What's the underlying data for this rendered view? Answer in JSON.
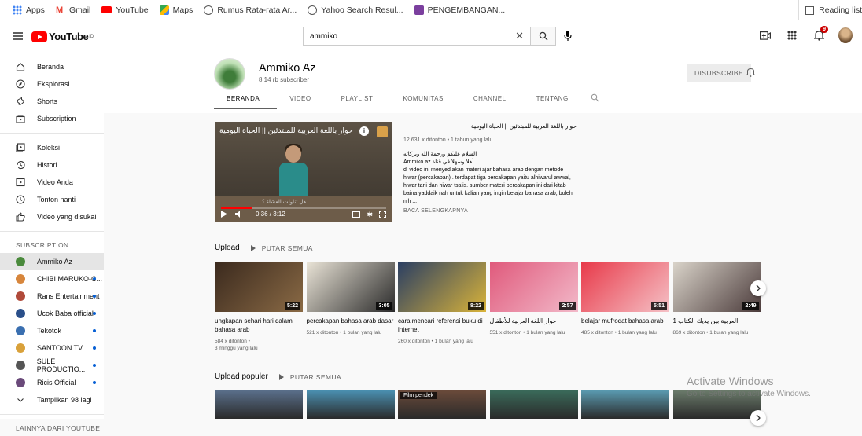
{
  "bookmarks": {
    "items": [
      {
        "label": "Apps",
        "icon": "apps-grid-icon",
        "color": "#4285f4"
      },
      {
        "label": "Gmail",
        "icon": "gmail-icon",
        "color": "#ea4335"
      },
      {
        "label": "YouTube",
        "icon": "youtube-icon",
        "color": "#ff0000"
      },
      {
        "label": "Maps",
        "icon": "maps-icon",
        "color": "#34a853"
      },
      {
        "label": "Rumus Rata-rata Ar...",
        "icon": "globe-icon",
        "color": "#555555"
      },
      {
        "label": "Yahoo Search Resul...",
        "icon": "globe-icon",
        "color": "#555555"
      },
      {
        "label": "PENGEMBANGAN...",
        "icon": "bookmark-favicon-icon",
        "color": "#7b3f9e"
      }
    ],
    "reading_list": "Reading list"
  },
  "masthead": {
    "logo_text": "YouTube",
    "logo_region": "ID",
    "search_value": "ammiko",
    "notification_count": "9"
  },
  "sidebar": {
    "main": [
      {
        "label": "Beranda",
        "icon": "home-icon"
      },
      {
        "label": "Eksplorasi",
        "icon": "compass-icon"
      },
      {
        "label": "Shorts",
        "icon": "shorts-icon"
      },
      {
        "label": "Subscription",
        "icon": "subscriptions-icon"
      }
    ],
    "library": [
      {
        "label": "Koleksi",
        "icon": "library-icon"
      },
      {
        "label": "Histori",
        "icon": "history-icon"
      },
      {
        "label": "Video Anda",
        "icon": "your-videos-icon"
      },
      {
        "label": "Tonton nanti",
        "icon": "watch-later-icon"
      },
      {
        "label": "Video yang disukai",
        "icon": "thumbs-up-icon"
      }
    ],
    "subscription_heading": "SUBSCRIPTION",
    "subscriptions": [
      {
        "label": "Ammiko Az",
        "active": true,
        "dot": false,
        "color": "#4a8a3c"
      },
      {
        "label": "CHIBI MARUKO-C...",
        "dot": true,
        "color": "#d7863c"
      },
      {
        "label": "Rans Entertainment",
        "dot": true,
        "color": "#b04a3a"
      },
      {
        "label": "Ucok Baba official",
        "dot": true,
        "color": "#2a4f8a"
      },
      {
        "label": "Tekotok",
        "dot": true,
        "color": "#3a6fb0"
      },
      {
        "label": "SANTOON TV",
        "dot": true,
        "color": "#d9a13a"
      },
      {
        "label": "SULE PRODUCTIO...",
        "dot": true,
        "color": "#555555"
      },
      {
        "label": "Ricis Official",
        "dot": true,
        "color": "#6a4a7a"
      }
    ],
    "show_more": "Tampilkan 98 lagi",
    "more_heading": "LAINNYA DARI YOUTUBE"
  },
  "channel": {
    "name": "Ammiko Az",
    "subscribers": "8,14 rb subscriber",
    "unsubscribe_label": "DISUBSCRIBE",
    "tabs": [
      "BERANDA",
      "VIDEO",
      "PLAYLIST",
      "KOMUNITAS",
      "CHANNEL",
      "TENTANG"
    ],
    "active_tab": 0
  },
  "featured": {
    "overlay_title": "حوار باللغة العربية للمبتدئين || الحياة اليومية",
    "overlay_subtitle": "هل تناولت العشاء ؟",
    "title": "حوار باللغة العربية للمبتدئين || الحياة اليومية",
    "time": "0:36 / 3:12",
    "progress": 0.19,
    "views": "12.631 x ditonton • 1 tahun yang lalu",
    "desc_arabic": "السلام عليكم ورحمة الله وبركاته",
    "desc_line2": "Ammiko az أهلا وسهلا في قناة",
    "description": "di video ini menyediakan materi ajar bahasa arab dengan metode hiwar (percakapan) . terdapat tiga percakapan yaitu alhiwarul awwal, hiwar tani dan hiwar tsalis. sumber materi percakapan ini dari kitab baina yaddaik nah untuk kalian yang ingin belajar bahasa arab, boleh nih ...",
    "read_more": "BACA SELENGKAPNYA"
  },
  "upload_shelf": {
    "title": "Upload",
    "play_all": "PUTAR SEMUA",
    "videos": [
      {
        "title": "ungkapan sehari hari dalam bahasa arab",
        "meta": "584 x ditonton •\n3 minggu yang lalu",
        "duration": "5:22",
        "colors": [
          "#3b2a1e",
          "#8a6a45"
        ]
      },
      {
        "title": "percakapan bahasa arab dasar",
        "meta": "521 x ditonton • 1 bulan yang lalu",
        "duration": "3:05",
        "colors": [
          "#e9e3d6",
          "#2a2a2a"
        ]
      },
      {
        "title": "cara mencari referensi buku di internet",
        "meta": "260 x ditonton • 1 bulan yang lalu",
        "duration": "8:22",
        "colors": [
          "#2b3f63",
          "#d9b33a"
        ]
      },
      {
        "title": "حوار اللغة العربية للأطفال",
        "meta": "551 x ditonton • 1 bulan yang lalu",
        "duration": "2:57",
        "colors": [
          "#e05a7c",
          "#f2b9c9"
        ]
      },
      {
        "title": "belajar mufrodat bahasa arab",
        "meta": "485 x ditonton • 1 bulan yang lalu",
        "duration": "5:51",
        "colors": [
          "#e83a4a",
          "#f5c1c6"
        ]
      },
      {
        "title": "العربية بين يديك الكتاب 1",
        "meta": "869 x ditonton • 1 bulan yang lalu",
        "duration": "2:49",
        "colors": [
          "#d9d3c9",
          "#4a3a3a"
        ]
      }
    ]
  },
  "popular_shelf": {
    "title": "Upload populer",
    "play_all": "PUTAR SEMUA",
    "short_label": "Film pendek",
    "thumb_colors": [
      "#5a6f8a",
      "#4a8fb0",
      "#6a4a3a",
      "#3a6a5a",
      "#5a9ab0",
      "#6a7a6a"
    ]
  },
  "watermark": {
    "line1": "Activate Windows",
    "line2": "Go to Settings to activate Windows."
  }
}
